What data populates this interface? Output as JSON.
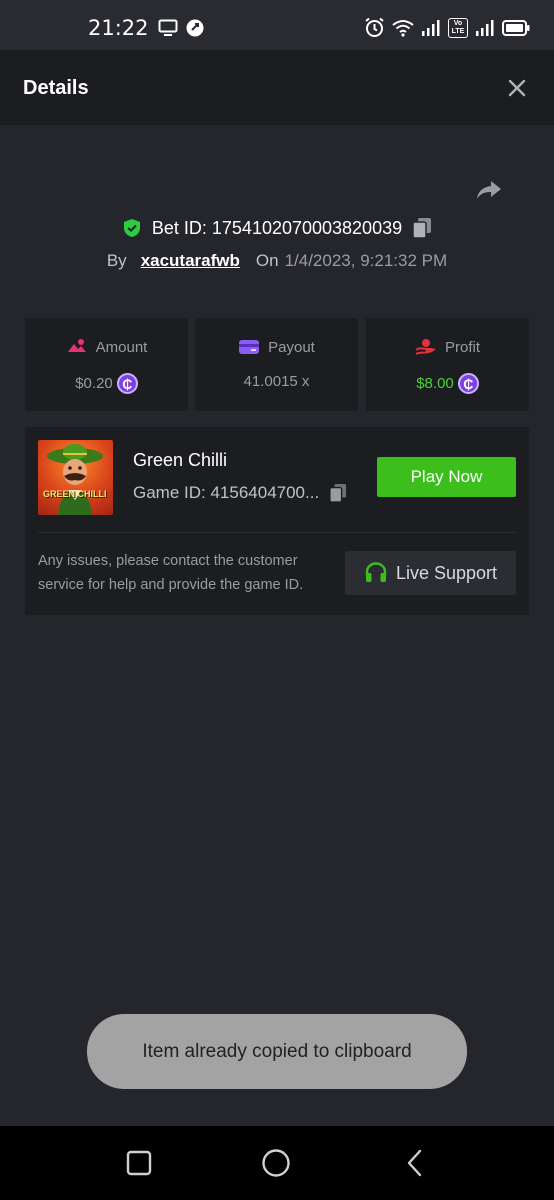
{
  "status_bar": {
    "time": "21:22",
    "left_icons": [
      "monitor-icon",
      "app-notification-icon"
    ],
    "right_icons": [
      "alarm-icon",
      "wifi-icon",
      "signal-icon",
      "volte-icon",
      "signal-icon",
      "battery-icon"
    ],
    "volte_label": "Vo LTE"
  },
  "header": {
    "title": "Details",
    "close_icon": "close-icon"
  },
  "bet": {
    "bet_id_label": "Bet ID: 1754102070003820039",
    "by_label": "By",
    "username": "xacutarafwb",
    "on_label": "On",
    "date": "1/4/2023, 9:21:32 PM"
  },
  "stats": {
    "amount": {
      "label": "Amount",
      "value": "$0.20",
      "icon": "amount-icon"
    },
    "payout": {
      "label": "Payout",
      "value": "41.0015 x",
      "icon": "card-icon"
    },
    "profit": {
      "label": "Profit",
      "value": "$8.00",
      "icon": "profit-icon"
    }
  },
  "game": {
    "thumbnail_text": "GREEN CHILLI",
    "name": "Green Chilli",
    "game_id": "Game ID: 4156404700...",
    "play_label": "Play Now",
    "support_text": "Any issues, please contact the customer service for help and provide the game ID.",
    "live_support_label": "Live Support"
  },
  "coin_symbol": "₵",
  "toast": {
    "message": "Item already copied to clipboard"
  },
  "colors": {
    "background": "#25262b",
    "panel": "#1c1d21",
    "accent_green": "#3cbf1c",
    "profit_green": "#4cd137",
    "coin_purple": "#7b3fe4",
    "amount_pink": "#e8336f",
    "card_purple": "#8b5cf6",
    "profit_red": "#e0313d",
    "shield_green": "#2ecc40"
  },
  "nav": {
    "buttons": [
      "recent-apps-icon",
      "home-icon",
      "back-icon"
    ]
  }
}
